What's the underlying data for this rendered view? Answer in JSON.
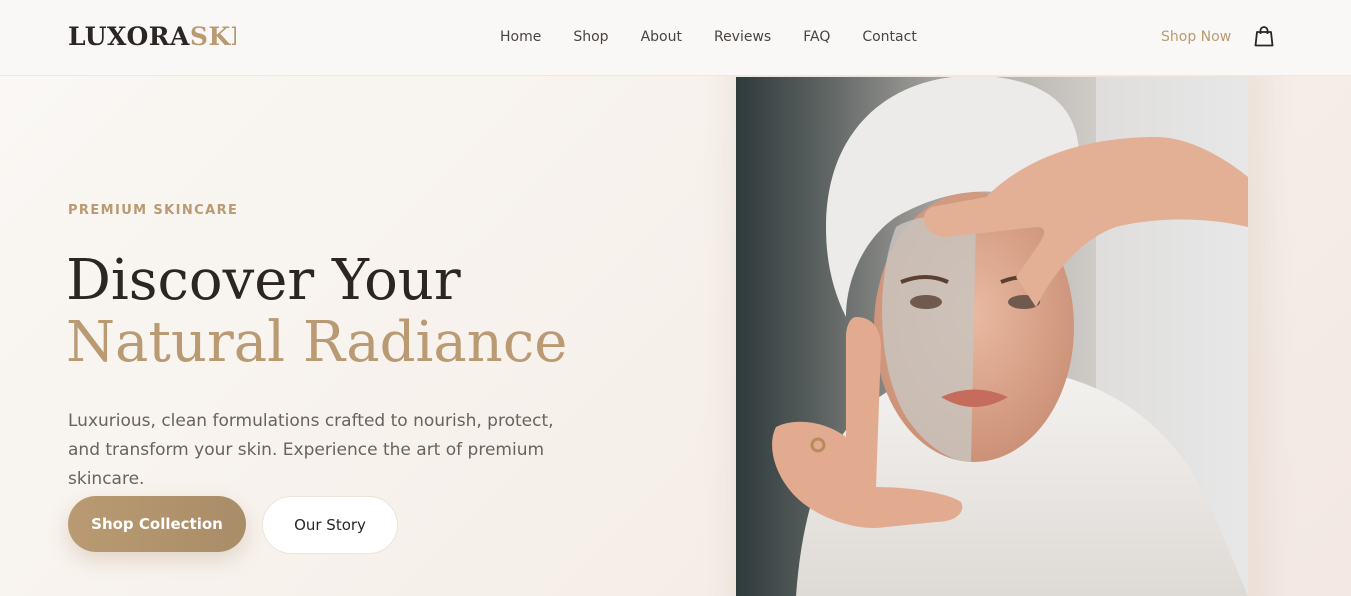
{
  "brand": {
    "logo_main": "LUXORA",
    "logo_accent": "SKIN"
  },
  "nav": {
    "items": [
      "Home",
      "Shop",
      "About",
      "Reviews",
      "FAQ",
      "Contact"
    ],
    "shop_now": "Shop Now",
    "cart_icon": "shopping-bag-icon"
  },
  "hero": {
    "eyebrow": "PREMIUM SKINCARE",
    "title_line1": "Discover Your",
    "title_line2": "Natural Radiance",
    "description": "Luxurious, clean formulations crafted to nourish, protect, and transform your skin. Experience the art of premium skincare.",
    "primary_cta": "Shop Collection",
    "secondary_cta": "Our Story"
  },
  "colors": {
    "accent": "#b99a72",
    "text_dark": "#2b2623",
    "text_muted": "#6a625d",
    "background": "#f6f1ec"
  }
}
